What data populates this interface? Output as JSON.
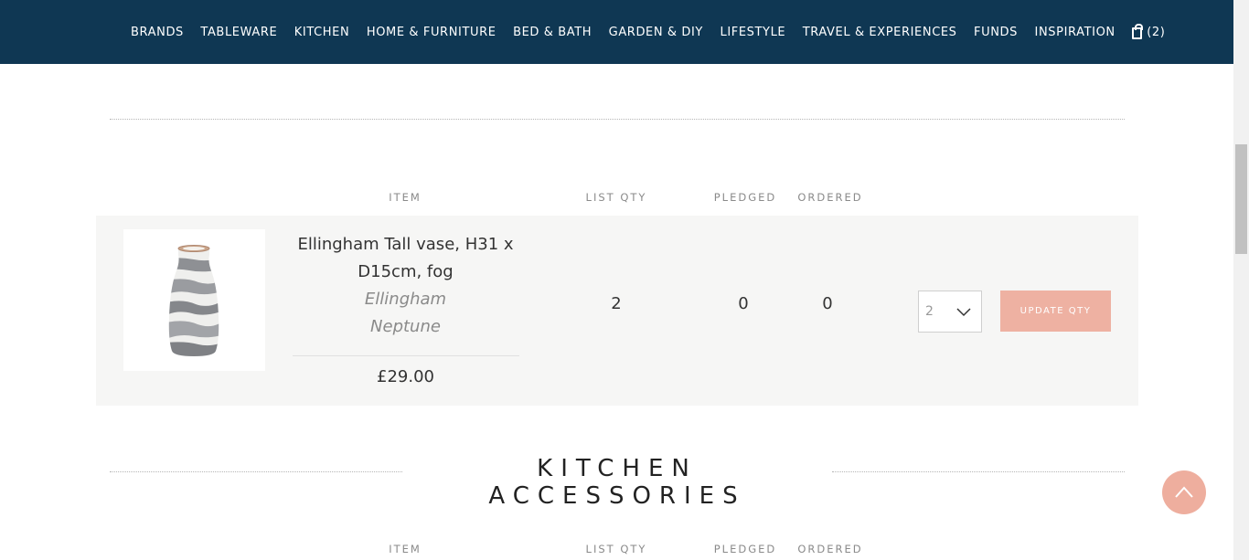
{
  "nav": {
    "items": [
      "BRANDS",
      "TABLEWARE",
      "KITCHEN",
      "HOME & FURNITURE",
      "BED & BATH",
      "GARDEN & DIY",
      "LIFESTYLE",
      "TRAVEL & EXPERIENCES",
      "FUNDS",
      "INSPIRATION"
    ],
    "cart_count": "(2)"
  },
  "table_headers": {
    "item": "ITEM",
    "list_qty": "LIST QTY",
    "pledged": "PLEDGED",
    "ordered": "ORDERED"
  },
  "item": {
    "name": "Ellingham Tall vase, H31 x D15cm, fog",
    "brand_line1": "Ellingham",
    "brand_line2": "Neptune",
    "price": "£29.00",
    "list_qty": "2",
    "pledged": "0",
    "ordered": "0",
    "qty_selected": "2",
    "update_label": "UPDATE QTY"
  },
  "next_section": {
    "title": "KITCHEN ACCESSORIES"
  },
  "colors": {
    "nav_bg": "#0f3753",
    "accent": "#eeb1a2",
    "row_bg": "#f6f6f5"
  }
}
